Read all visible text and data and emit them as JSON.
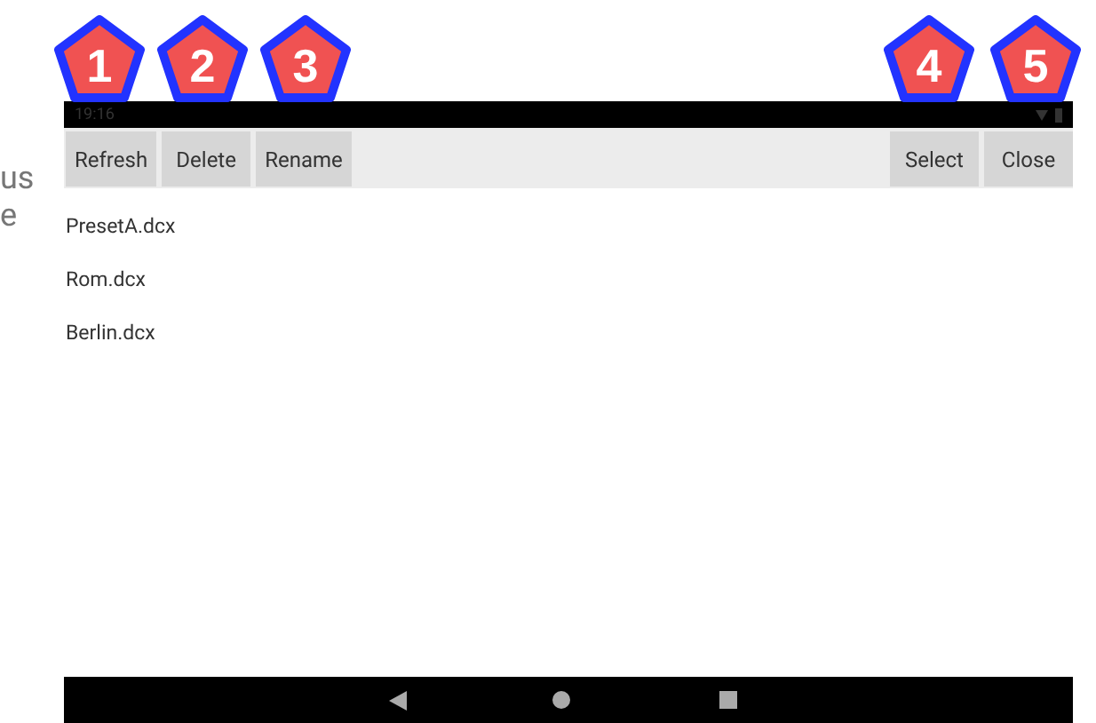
{
  "background_text": [
    "us",
    "e"
  ],
  "callouts": [
    "1",
    "2",
    "3",
    "4",
    "5"
  ],
  "status_bar": {
    "time": "19:16"
  },
  "toolbar": {
    "left_buttons": [
      "Refresh",
      "Delete",
      "Rename"
    ],
    "right_buttons": [
      "Select",
      "Close"
    ]
  },
  "files": [
    "PresetA.dcx",
    "Rom.dcx",
    "Berlin.dcx"
  ]
}
